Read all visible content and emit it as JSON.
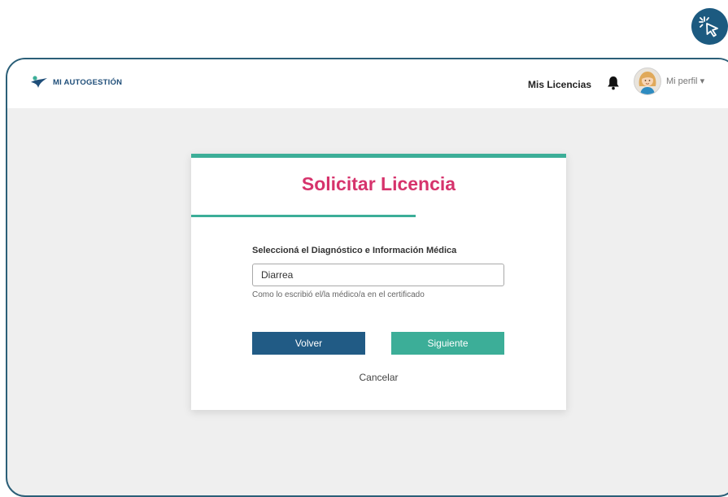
{
  "header": {
    "logo_text": "MI AUTOGESTIÓN",
    "nav_licencias": "Mis Licencias",
    "profile_label": "Mi perfil",
    "profile_caret": "▾"
  },
  "card": {
    "title": "Solicitar Licencia",
    "field_label": "Seleccioná el Diagnóstico e Información Médica",
    "diagnosis_value": "Diarrea",
    "hint": "Como lo escribió el/la médico/a en el certificado",
    "back_label": "Volver",
    "next_label": "Siguiente",
    "cancel_label": "Cancelar"
  },
  "colors": {
    "accent_teal": "#3cae98",
    "title_pink": "#d6336c",
    "primary_blue": "#215b85",
    "frame_border": "#2b5f78"
  },
  "icons": {
    "click_indicator": "cursor-click-icon",
    "logo": "logo-figure-icon",
    "notifications": "bell-icon",
    "avatar": "user-avatar-icon"
  }
}
